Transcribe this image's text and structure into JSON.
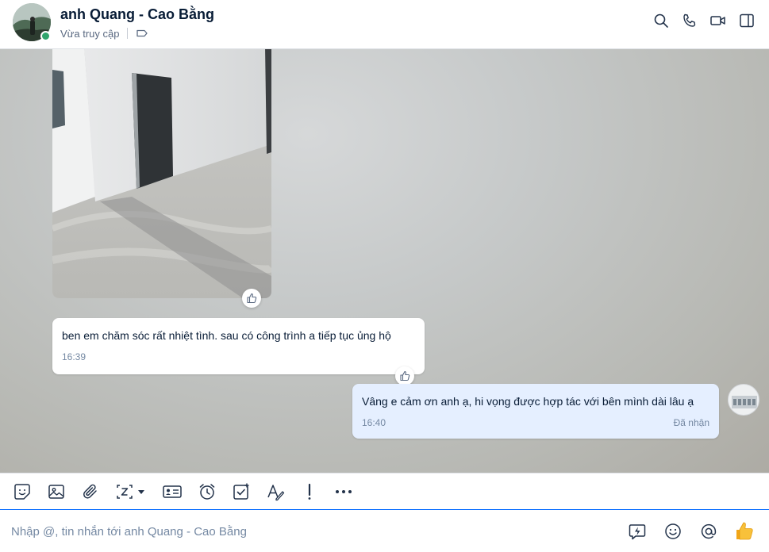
{
  "header": {
    "contact_name": "anh Quang - Cao Bằng",
    "status": "Vừa truy cập",
    "icons": [
      "search-icon",
      "phone-icon",
      "video-call-icon",
      "sidebar-toggle-icon"
    ]
  },
  "messages": [
    {
      "type": "image",
      "icon": "thumbs-up-icon"
    },
    {
      "type": "text",
      "text": "ben em chăm sóc rất nhiệt tình. sau có công trình a tiếp tục ủng hộ",
      "time": "16:39",
      "icon": "thumbs-up-icon"
    },
    {
      "type": "text",
      "mine": true,
      "text": "Vâng e cảm ơn anh ạ, hi vọng được hợp tác với bên mình dài lâu ạ",
      "time": "16:40",
      "status": "Đã nhận"
    }
  ],
  "toolbar": {
    "icons": [
      "sticker-icon",
      "image-icon",
      "paperclip-icon",
      "screenshot-icon",
      "business-card-icon",
      "alarm-clock-icon",
      "todo-checkbox-icon",
      "text-format-icon",
      "urgent-icon",
      "more-icon"
    ],
    "more_label": "•••"
  },
  "composer": {
    "placeholder": "Nhập @, tin nhắn tới anh Quang - Cao Bằng",
    "icons": [
      "quick-message-icon",
      "emoji-icon",
      "mention-icon",
      "thumbs-up-send-icon"
    ]
  },
  "colors": {
    "accent": "#0068ff",
    "my_bubble": "#e5efff",
    "online": "#30a46c",
    "text": "#081c36",
    "muted": "#7589a3"
  }
}
